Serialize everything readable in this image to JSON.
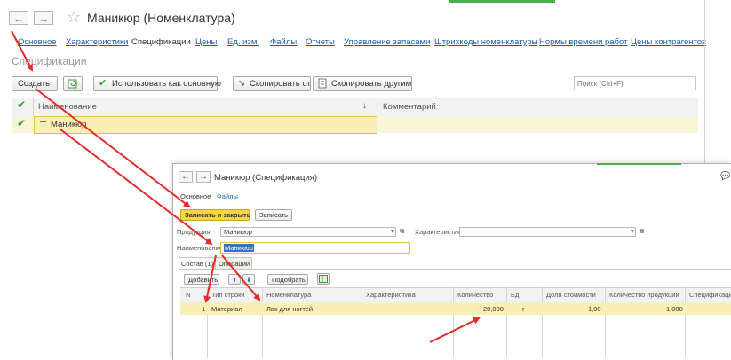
{
  "main": {
    "nav": {
      "back": "←",
      "forward": "→"
    },
    "title": "Маникюр (Номенклатура)",
    "tabs": [
      "Основное",
      "Характеристики",
      "Спецификации",
      "Цены",
      "Ед. изм.",
      "Файлы",
      "Отчеты",
      "Управление запасами",
      "Штрихкоды номенклатуры",
      "Нормы времени работ",
      "Цены контрагентов"
    ],
    "active_tab": "Спецификации",
    "section_title": "Спецификации",
    "toolbar": {
      "create": "Создать",
      "use_as_main": "Использовать как основную",
      "copy_from": "Скопировать от",
      "copy_to_others": "Скопировать другим",
      "search_placeholder": "Поиск (Ctrl+F)"
    },
    "table": {
      "col_name": "Наименование",
      "col_comment": "Комментарий",
      "sort_icon": "↓",
      "rows": [
        {
          "name": "Маникюр",
          "comment": ""
        }
      ]
    }
  },
  "spec": {
    "nav": {
      "back": "←",
      "forward": "→"
    },
    "title": "Маникюр (Спецификация)",
    "tabs": [
      "Основное",
      "Файлы"
    ],
    "toolbar": {
      "save_close": "Записать и закрыть",
      "save": "Записать"
    },
    "fields": {
      "product_label": "Продукция:",
      "product_value": "Маникюр",
      "characteristic_label": "Характеристика:",
      "characteristic_value": "",
      "name_label": "Наименование:",
      "name_value": "Маникюр"
    },
    "subtabs": [
      "Состав (1)",
      "Операции"
    ],
    "table_toolbar": {
      "add": "Добавить",
      "select": "Подобрать"
    },
    "columns": [
      "N",
      "Тип строки",
      "Номенклатура",
      "Характеристика",
      "Количество",
      "Ед.",
      "Доля стоимости",
      "Количество продукции",
      "Спецификация"
    ],
    "rows": [
      {
        "n": "1",
        "type": "Материал",
        "item": "Лак для ногтей",
        "char": "",
        "qty": "20,000",
        "unit": "г",
        "share": "1,00",
        "prod_qty": "1,000",
        "spec": ""
      }
    ]
  },
  "colors": {
    "link": "#1a5ea8",
    "highlight": "#faf0b5",
    "save_button": "#f5d83a",
    "arrow": "#e8292b",
    "check": "#3a9a3a"
  }
}
